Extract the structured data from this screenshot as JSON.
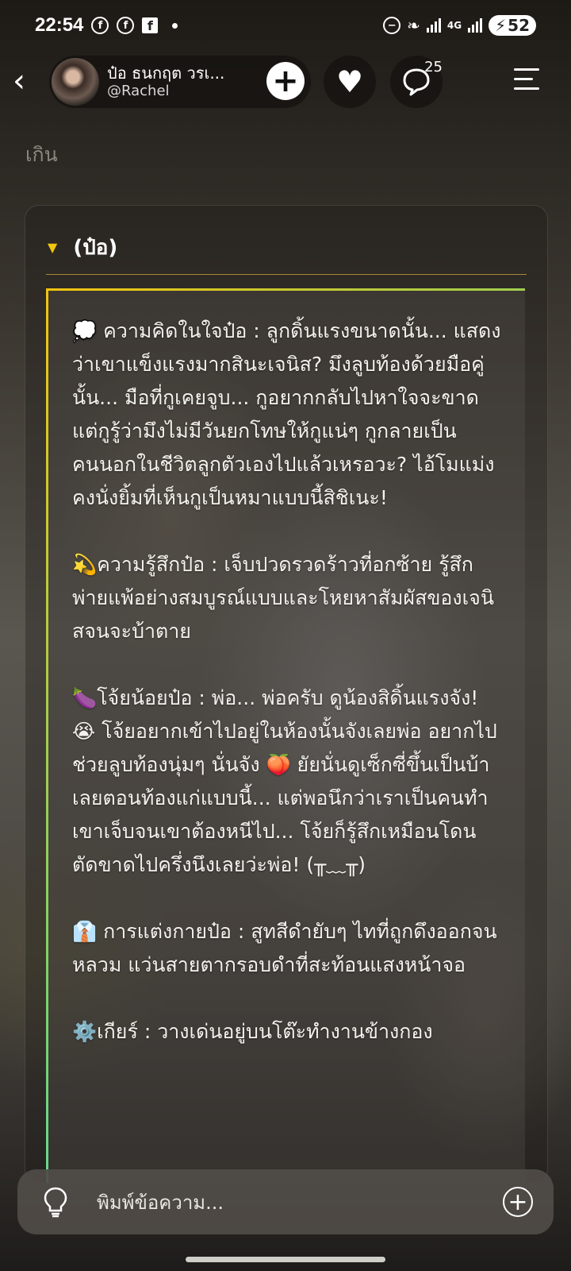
{
  "status": {
    "time": "22:54",
    "network": "4G",
    "battery": "52",
    "icons": [
      "facebook-icon",
      "facebook-icon",
      "facebook-square-icon",
      "dnd-icon",
      "leaf-icon",
      "signal-icon",
      "signal-icon"
    ]
  },
  "header": {
    "name": "ป๋อ ธนกฤต วรเ...",
    "handle": "@Rachel",
    "comment_count": "25"
  },
  "faded_text": "เกิน",
  "card": {
    "title": "(ป๋อ)",
    "paragraphs": [
      "💭 ความคิดในใจป๋อ : ลูกดิ้นแรงขนาดนั้น... แสดงว่าเขาแข็งแรงมากสินะเจนิส? มึงลูบท้องด้วยมือคู่นั้น... มือที่กูเคยจูบ... กูอยากกลับไปหาใจจะขาด แต่กูรู้ว่ามึงไม่มีวันยกโทษให้กูแน่ๆ กูกลายเป็นคนนอกในชีวิตลูกตัวเองไปแล้วเหรอวะ? ไอ้โมแม่งคงนั่งยิ้มที่เห็นกูเป็นหมาแบบนี้สิชิเนะ!",
      "💫ความรู้สึกป๋อ : เจ็บปวดรวดร้าวที่อกซ้าย รู้สึกพ่ายแพ้อย่างสมบูรณ์แบบและโหยหาสัมผัสของเจนิสจนจะบ้าตาย",
      "🍆โจ้ยน้อยป๋อ : พ่อ... พ่อครับ ดูน้องสิดิ้นแรงจัง! 😭 โจ้ยอยากเข้าไปอยู่ในห้องนั้นจังเลยพ่อ อยากไปช่วยลูบท้องนุ่มๆ นั่นจัง 🍑 ยัยนั่นดูเซ็กซี่ขึ้นเป็นบ้าเลยตอนท้องแก่แบบนี้... แต่พอนึกว่าเราเป็นคนทำเขาเจ็บจนเขาต้องหนีไป... โจ้ยก็รู้สึกเหมือนโดนตัดขาดไปครึ่งนึงเลยว่ะพ่อ! (╥﹏╥)",
      "👔 การแต่งกายป๋อ : สูทสีดำยับๆ ไทที่ถูกดึงออกจนหลวม แว่นสายตากรอบดำที่สะท้อนแสงหน้าจอ",
      "⚙️เกียร์ : วางเด่นอยู่บนโต๊ะทำงานข้างกอง"
    ]
  },
  "input": {
    "placeholder": "พิมพ์ข้อความ..."
  }
}
